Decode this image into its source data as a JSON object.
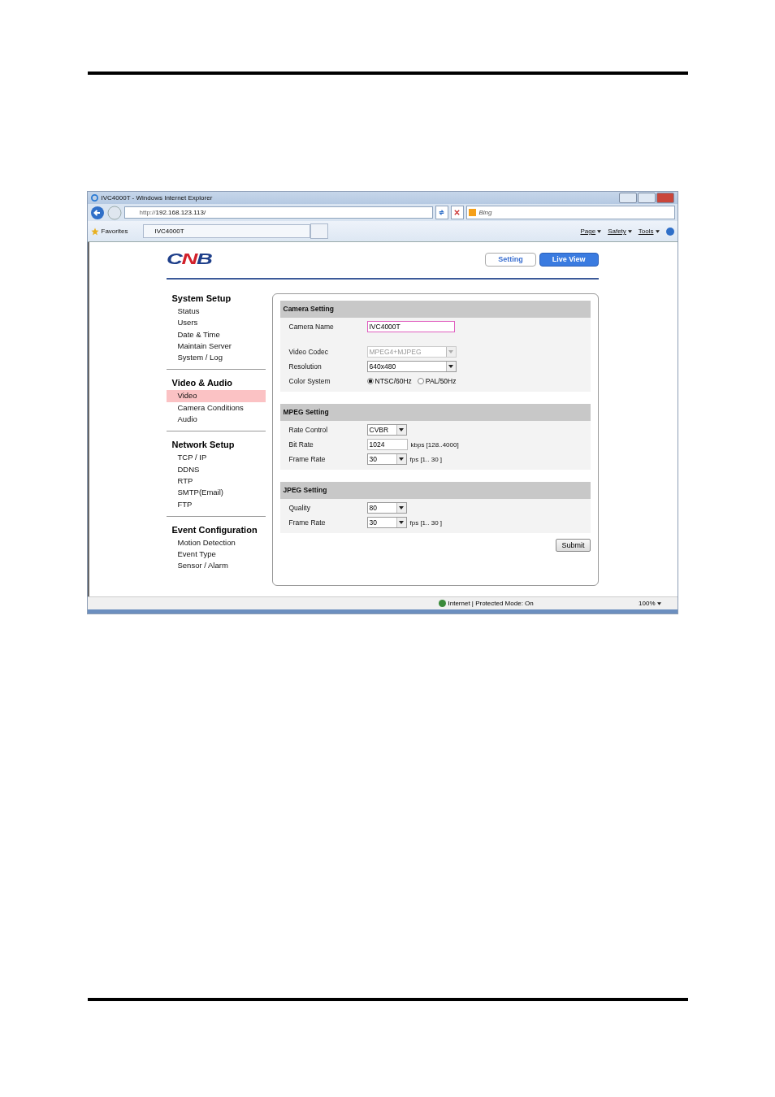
{
  "window": {
    "title": "IVC4000T - Windows Internet Explorer"
  },
  "address_bar": {
    "url_prefix": "http://",
    "url_host": "192.168.123.113/",
    "search_placeholder": "Bing"
  },
  "favorites_bar": {
    "favorites": "Favorites",
    "tab_title": "IVC4000T",
    "menus": [
      "Page",
      "Safety",
      "Tools"
    ]
  },
  "page": {
    "logo": "CNB",
    "header_buttons": [
      {
        "label": "Setting",
        "kind": "outline"
      },
      {
        "label": "Live View",
        "kind": "primary"
      }
    ],
    "sidebar": [
      {
        "heading": "System Setup",
        "items": [
          {
            "label": "Status",
            "selected": false
          },
          {
            "label": "Users",
            "selected": false
          },
          {
            "label": "Date & Time",
            "selected": false
          },
          {
            "label": "Maintain Server",
            "selected": false
          },
          {
            "label": "System / Log",
            "selected": false
          }
        ]
      },
      {
        "heading": "Video & Audio",
        "items": [
          {
            "label": "Video",
            "selected": true
          },
          {
            "label": "Camera Conditions",
            "selected": false
          },
          {
            "label": "Audio",
            "selected": false
          }
        ]
      },
      {
        "heading": "Network Setup",
        "items": [
          {
            "label": "TCP / IP",
            "selected": false
          },
          {
            "label": "DDNS",
            "selected": false
          },
          {
            "label": "RTP",
            "selected": false
          },
          {
            "label": "SMTP(Email)",
            "selected": false
          },
          {
            "label": "FTP",
            "selected": false
          }
        ]
      },
      {
        "heading": "Event Configuration",
        "items": [
          {
            "label": "Motion Detection",
            "selected": false
          },
          {
            "label": "Event Type",
            "selected": false
          },
          {
            "label": "Sensor / Alarm",
            "selected": false
          }
        ]
      }
    ],
    "sections": [
      {
        "title": "Camera Setting",
        "rows": [
          {
            "kind": "text",
            "label": "Camera Name",
            "value": "IVC4000T",
            "focused": true
          },
          {
            "kind": "gap"
          },
          {
            "kind": "select",
            "label": "Video Codec",
            "value": "MPEG4+MJPEG",
            "disabled": true
          },
          {
            "kind": "select",
            "label": "Resolution",
            "value": "640x480",
            "disabled": false
          },
          {
            "kind": "radio",
            "label": "Color System",
            "options": [
              {
                "label": "NTSC/60Hz",
                "selected": true
              },
              {
                "label": "PAL/50Hz",
                "selected": false
              }
            ]
          }
        ]
      },
      {
        "title": "MPEG Setting",
        "rows": [
          {
            "kind": "select",
            "label": "Rate Control",
            "value": "CVBR",
            "disabled": false
          },
          {
            "kind": "text",
            "label": "Bit Rate",
            "value": "1024",
            "focused": false,
            "hint": "kbps [128..4000]"
          },
          {
            "kind": "select",
            "label": "Frame Rate",
            "value": "30",
            "disabled": false,
            "hint": "fps [1.. 30 ]"
          }
        ]
      },
      {
        "title": "JPEG Setting",
        "rows": [
          {
            "kind": "select",
            "label": "Quality",
            "value": "80",
            "disabled": false
          },
          {
            "kind": "select",
            "label": "Frame Rate",
            "value": "30",
            "disabled": false,
            "hint": "fps [1.. 30 ]"
          }
        ]
      }
    ],
    "submit": "Submit"
  },
  "status_bar": {
    "text": "Internet | Protected Mode: On",
    "zoom": "100%"
  }
}
